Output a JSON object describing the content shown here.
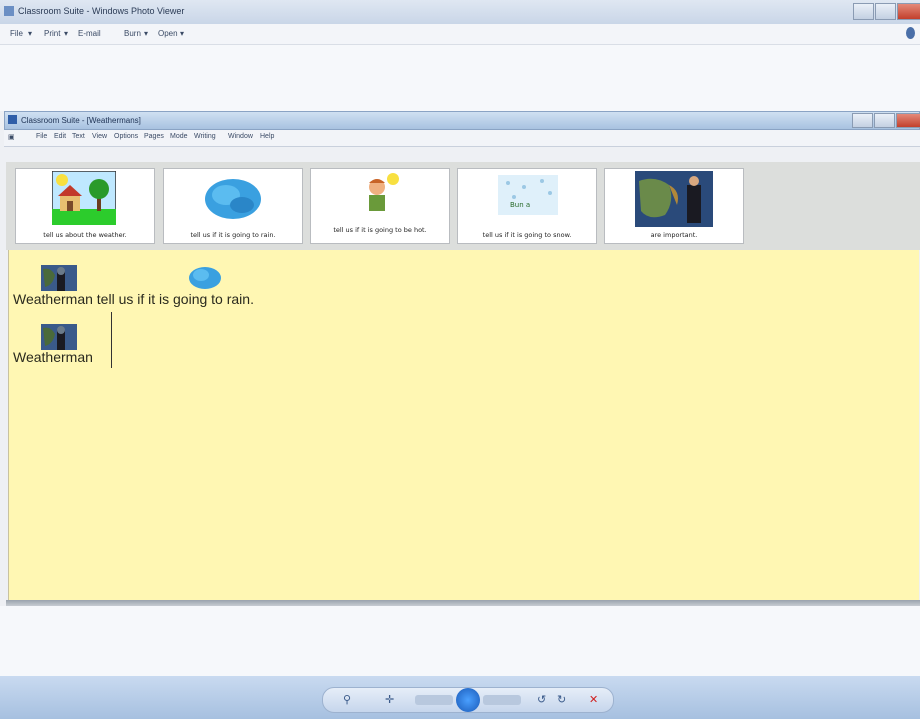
{
  "viewer": {
    "title": "Classroom Suite - Windows Photo Viewer",
    "menu": [
      "File",
      "Print",
      "E-mail",
      "Burn",
      "Open"
    ]
  },
  "app": {
    "title": "Classroom Suite - [Weathermans]",
    "menu": [
      "File",
      "Edit",
      "Text",
      "View",
      "Options",
      "Pages",
      "Mode",
      "Writing",
      "Window",
      "Help"
    ]
  },
  "cards": [
    {
      "caption": "tell us about the weather.",
      "icon": "house-tree-sun-picture"
    },
    {
      "caption": "tell us if it is going to rain.",
      "icon": "rain-cloud-picture"
    },
    {
      "caption": "tell us if it is going to be hot.",
      "icon": "hot-person-picture"
    },
    {
      "caption": "tell us if it is going to snow.",
      "icon": "snow-picture"
    },
    {
      "caption": "are important.",
      "icon": "weatherman-photo"
    }
  ],
  "snow_label": "Bun a",
  "document": {
    "line1": "Weatherman tell us if it is going to rain.",
    "line2": "Weatherman"
  },
  "colors": {
    "document_bg": "#fff7b3",
    "toolbar_bg": "#dcdedc",
    "taskbar": "#a6c0e0"
  }
}
